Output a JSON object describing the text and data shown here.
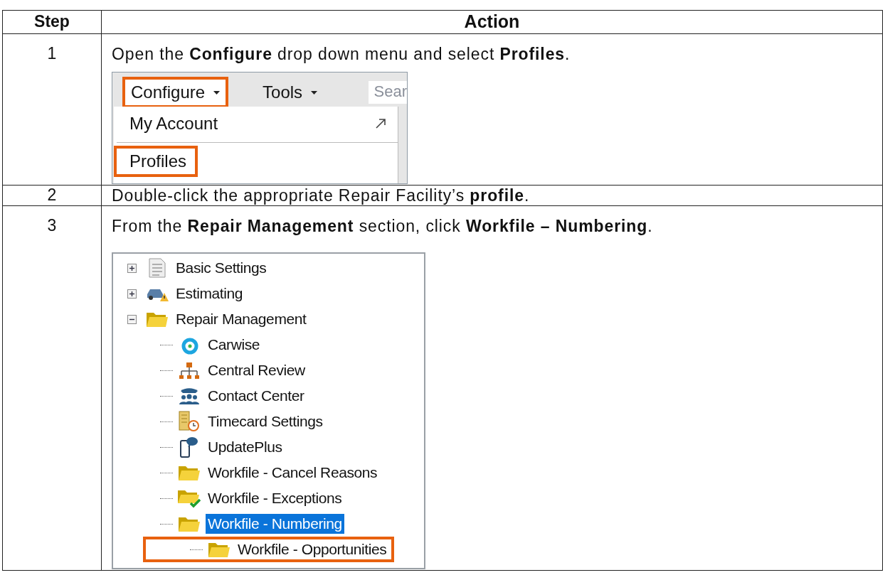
{
  "table": {
    "columns": [
      "Step",
      "Action"
    ],
    "rows": [
      {
        "step": "1",
        "instruction": "Open the **Configure** drop down menu and select **Profiles**.",
        "figure": {
          "kind": "menu",
          "menubar": [
            {
              "label": "Configure",
              "dropdown": true,
              "highlighted": true
            },
            {
              "label": "Tools",
              "dropdown": true,
              "highlighted": false
            }
          ],
          "search": {
            "placeholder": "Sear"
          },
          "items": [
            {
              "label": "My Account",
              "external": true,
              "highlighted": false
            },
            {
              "label": "Profiles",
              "external": false,
              "highlighted": true
            }
          ]
        }
      },
      {
        "step": "2",
        "instruction": "Double-click the appropriate Repair Facility’s **profile**."
      },
      {
        "step": "3",
        "instruction": "From the **Repair Management** section, click **Workfile – Numbering**.",
        "figure": {
          "kind": "tree",
          "nodes": [
            {
              "label": "Basic Settings",
              "kind": "document",
              "expanded": false,
              "selected": false,
              "highlighted": false
            },
            {
              "label": "Estimating",
              "kind": "car",
              "expanded": false,
              "selected": false,
              "highlighted": false
            },
            {
              "label": "Repair Management",
              "kind": "folder",
              "expanded": true,
              "selected": false,
              "highlighted": false,
              "children": [
                {
                  "label": "Carwise",
                  "kind": "ring",
                  "selected": false,
                  "highlighted": false
                },
                {
                  "label": "Central Review",
                  "kind": "hierarchy",
                  "selected": false,
                  "highlighted": false
                },
                {
                  "label": "Contact Center",
                  "kind": "people",
                  "selected": false,
                  "highlighted": false
                },
                {
                  "label": "Timecard Settings",
                  "kind": "timecard",
                  "selected": false,
                  "highlighted": false
                },
                {
                  "label": "UpdatePlus",
                  "kind": "phone",
                  "selected": false,
                  "highlighted": false
                },
                {
                  "label": "Workfile - Cancel Reasons",
                  "kind": "folder",
                  "selected": false,
                  "highlighted": false
                },
                {
                  "label": "Workfile - Exceptions",
                  "kind": "folder-check",
                  "selected": false,
                  "highlighted": false
                },
                {
                  "label": "Workfile - Numbering",
                  "kind": "folder",
                  "selected": true,
                  "highlighted": false
                },
                {
                  "label": "Workfile - Opportunities",
                  "kind": "folder",
                  "selected": false,
                  "highlighted": true
                }
              ]
            }
          ]
        }
      }
    ]
  }
}
